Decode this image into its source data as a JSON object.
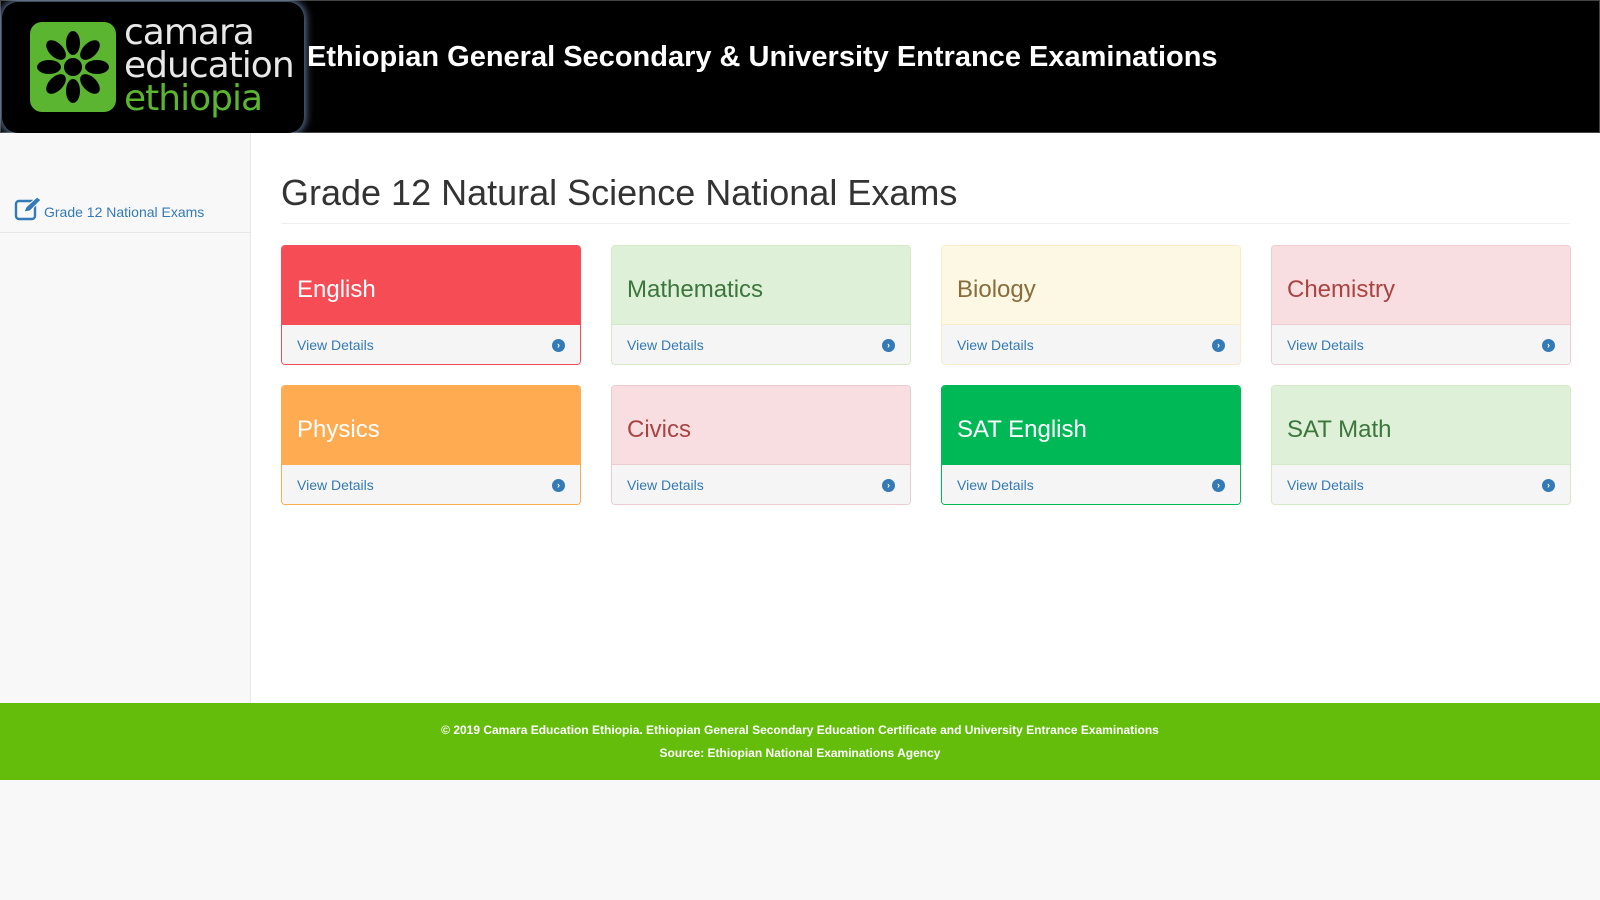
{
  "header": {
    "logo": {
      "line1": "camara",
      "line2": "education",
      "line3": "ethiopia"
    },
    "title": "Ethiopian General Secondary & University Entrance Examinations"
  },
  "sidebar": {
    "items": [
      {
        "label": "Grade 12 National Exams",
        "icon": "edit-icon"
      }
    ]
  },
  "main": {
    "title": "Grade 12 Natural Science National Exams",
    "cards": [
      {
        "subject": "English",
        "link": "View Details",
        "head_bg": "#f64c55",
        "head_color": "#ffffff",
        "border": "#f64c55"
      },
      {
        "subject": "Mathematics",
        "link": "View Details",
        "head_bg": "#dff0d8",
        "head_color": "#3c763d",
        "border": "#d6e9c6"
      },
      {
        "subject": "Biology",
        "link": "View Details",
        "head_bg": "#fcf8e3",
        "head_color": "#8a6d3b",
        "border": "#faebcc"
      },
      {
        "subject": "Chemistry",
        "link": "View Details",
        "head_bg": "#f8dee0",
        "head_color": "#a94442",
        "border": "#ebccd1"
      },
      {
        "subject": "Physics",
        "link": "View Details",
        "head_bg": "#ffab51",
        "head_color": "#ffffff",
        "border": "#ffab51"
      },
      {
        "subject": "Civics",
        "link": "View Details",
        "head_bg": "#f8dee0",
        "head_color": "#a94442",
        "border": "#ebccd1"
      },
      {
        "subject": "SAT English",
        "link": "View Details",
        "head_bg": "#00b956",
        "head_color": "#ffffff",
        "border": "#00b956"
      },
      {
        "subject": "SAT Math",
        "link": "View Details",
        "head_bg": "#dff0d8",
        "head_color": "#3c763d",
        "border": "#d6e9c6"
      }
    ]
  },
  "footer": {
    "line1": "© 2019 Camara Education Ethiopia. Ethiopian General Secondary Education Certificate and University Entrance Examinations",
    "line2": "Source: Ethiopian National Examinations Agency"
  },
  "colors": {
    "header_bg": "#000000",
    "footer_bg": "#64bd0b",
    "link": "#337ab7",
    "logo_green": "#5cb531"
  }
}
